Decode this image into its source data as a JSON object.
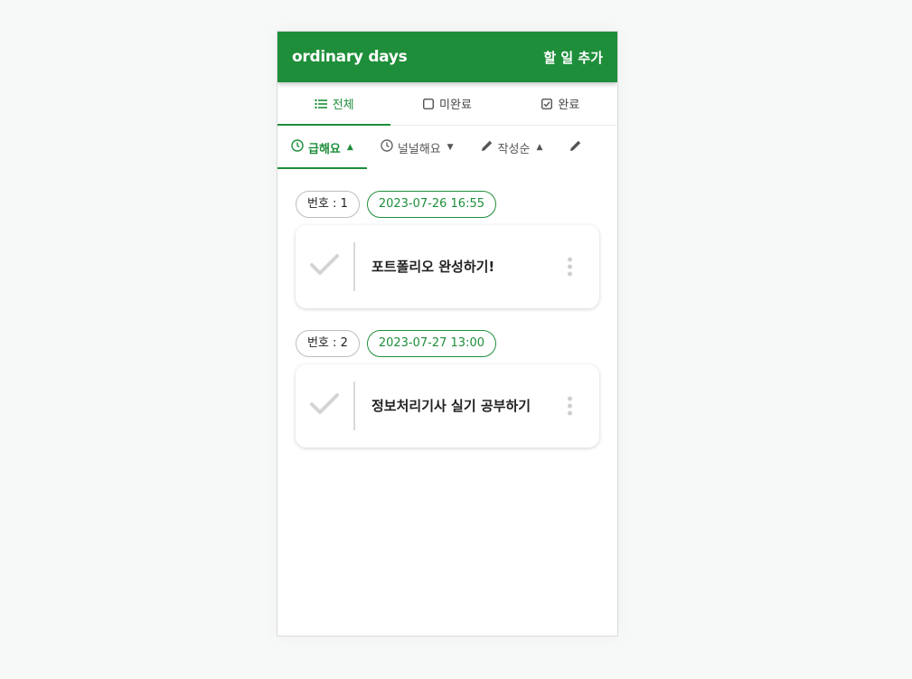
{
  "header": {
    "brand": "ordinary days",
    "add_label": "할 일 추가"
  },
  "tabs": [
    {
      "label": "전체",
      "icon": "list-icon",
      "active": true
    },
    {
      "label": "미완료",
      "icon": "checkbox-empty-icon",
      "active": false
    },
    {
      "label": "완료",
      "icon": "checkbox-checked-icon",
      "active": false
    }
  ],
  "sorts": [
    {
      "label": "급해요",
      "icon": "clock-icon",
      "arrow": "▲",
      "active": true
    },
    {
      "label": "널널해요",
      "icon": "clock-icon",
      "arrow": "▼",
      "active": false
    },
    {
      "label": "작성순",
      "icon": "pencil-icon",
      "arrow": "▲",
      "active": false
    },
    {
      "label": "",
      "icon": "pencil-icon",
      "arrow": "",
      "active": false
    }
  ],
  "todos": [
    {
      "number_label": "번호 : 1",
      "date": "2023-07-26 16:55",
      "title": "포트폴리오 완성하기!"
    },
    {
      "number_label": "번호 : 2",
      "date": "2023-07-27 13:00",
      "title": "정보처리기사 실기 공부하기"
    }
  ],
  "colors": {
    "accent": "#1e8e3a",
    "background": "#f7f9f8"
  }
}
